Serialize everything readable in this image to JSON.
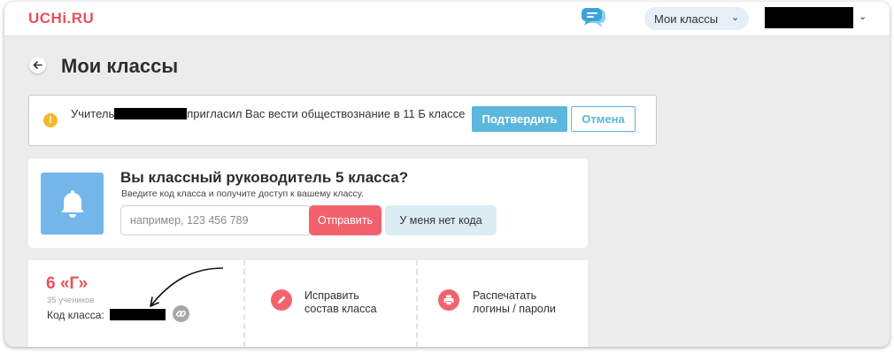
{
  "header": {
    "logo": "UCHi.RU",
    "classes_dropdown": "Мои классы",
    "icons": {
      "chat": "chat-bubbles-icon",
      "chevron": "chevron-down-icon"
    }
  },
  "page": {
    "title": "Мои классы",
    "back_icon": "arrow-left-icon"
  },
  "invite": {
    "icon": "warning-icon",
    "text_before": "Учитель",
    "text_after": "пригласил Вас вести обществознание в 11 Б классе",
    "confirm": "Подтвердить",
    "cancel": "Отмена"
  },
  "homeroom": {
    "icon": "bell-icon",
    "title": "Вы классный руководитель 5 класса?",
    "subtitle": "Введите код класса и получите доступ к вашему классу.",
    "input_placeholder": "например, 123 456 789",
    "send": "Отправить",
    "no_code": "У меня нет кода"
  },
  "class_card": {
    "name": "6 «Г»",
    "students": "35 учеников",
    "code_label": "Код класса:",
    "link_icon": "link-icon",
    "actions": [
      {
        "line1": "Исправить",
        "line2": "состав класса",
        "icon": "pencil-icon"
      },
      {
        "line1": "Распечатать",
        "line2": "логины / пароли",
        "icon": "printer-icon"
      }
    ]
  },
  "colors": {
    "accent_red": "#e8505b",
    "button_blue": "#5bb7dd",
    "bell_blue": "#72b6ea",
    "warning_yellow": "#f5b82e",
    "background": "#ececec"
  }
}
